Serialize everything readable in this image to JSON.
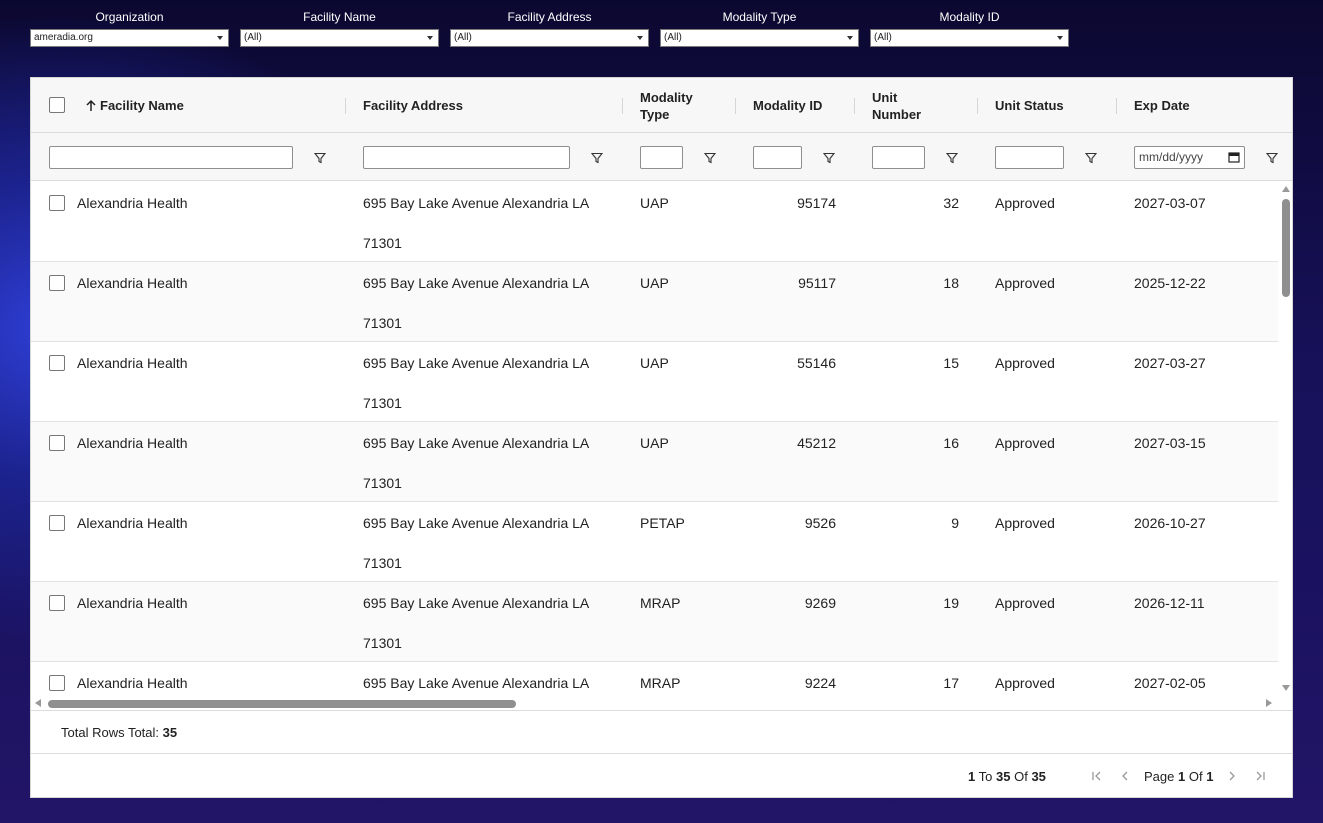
{
  "top_filters": [
    {
      "label": "Organization",
      "value": "ameradia.org"
    },
    {
      "label": "Facility Name",
      "value": "(All)"
    },
    {
      "label": "Facility Address",
      "value": "(All)"
    },
    {
      "label": "Modality Type",
      "value": "(All)"
    },
    {
      "label": "Modality ID",
      "value": "(All)"
    }
  ],
  "grid": {
    "columns": {
      "facility_name": "Facility Name",
      "facility_address": "Facility Address",
      "modality_type": "Modality Type",
      "modality_id": "Modality ID",
      "unit_number": "Unit Number",
      "unit_status": "Unit Status",
      "exp_date": "Exp Date"
    },
    "sort_icon": "arrow-up-icon",
    "filter_icon": "funnel-icon",
    "date_placeholder": "mm/dd/yyyy",
    "rows": [
      {
        "facility_name": "Alexandria Health",
        "address_line1": "695 Bay Lake Avenue Alexandria LA",
        "address_line2": "71301",
        "modality_type": "UAP",
        "modality_id": "95174",
        "unit_number": "32",
        "unit_status": "Approved",
        "exp_date": "2027-03-07"
      },
      {
        "facility_name": "Alexandria Health",
        "address_line1": "695 Bay Lake Avenue Alexandria LA",
        "address_line2": "71301",
        "modality_type": "UAP",
        "modality_id": "95117",
        "unit_number": "18",
        "unit_status": "Approved",
        "exp_date": "2025-12-22"
      },
      {
        "facility_name": "Alexandria Health",
        "address_line1": "695 Bay Lake Avenue Alexandria LA",
        "address_line2": "71301",
        "modality_type": "UAP",
        "modality_id": "55146",
        "unit_number": "15",
        "unit_status": "Approved",
        "exp_date": "2027-03-27"
      },
      {
        "facility_name": "Alexandria Health",
        "address_line1": "695 Bay Lake Avenue Alexandria LA",
        "address_line2": "71301",
        "modality_type": "UAP",
        "modality_id": "45212",
        "unit_number": "16",
        "unit_status": "Approved",
        "exp_date": "2027-03-15"
      },
      {
        "facility_name": "Alexandria Health",
        "address_line1": "695 Bay Lake Avenue Alexandria LA",
        "address_line2": "71301",
        "modality_type": "PETAP",
        "modality_id": "9526",
        "unit_number": "9",
        "unit_status": "Approved",
        "exp_date": "2026-10-27"
      },
      {
        "facility_name": "Alexandria Health",
        "address_line1": "695 Bay Lake Avenue Alexandria LA",
        "address_line2": "71301",
        "modality_type": "MRAP",
        "modality_id": "9269",
        "unit_number": "19",
        "unit_status": "Approved",
        "exp_date": "2026-12-11"
      },
      {
        "facility_name": "Alexandria Health",
        "address_line1": "695 Bay Lake Avenue Alexandria LA",
        "address_line2": "",
        "modality_type": "MRAP",
        "modality_id": "9224",
        "unit_number": "17",
        "unit_status": "Approved",
        "exp_date": "2027-02-05"
      }
    ]
  },
  "footer": {
    "total_label": "Total Rows Total:",
    "total_value": "35",
    "range_from": "1",
    "range_to_label": "To",
    "range_to": "35",
    "range_of_label": "Of",
    "range_total": "35",
    "page_label": "Page",
    "page_current": "1",
    "page_of_label": "Of",
    "page_total": "1"
  }
}
